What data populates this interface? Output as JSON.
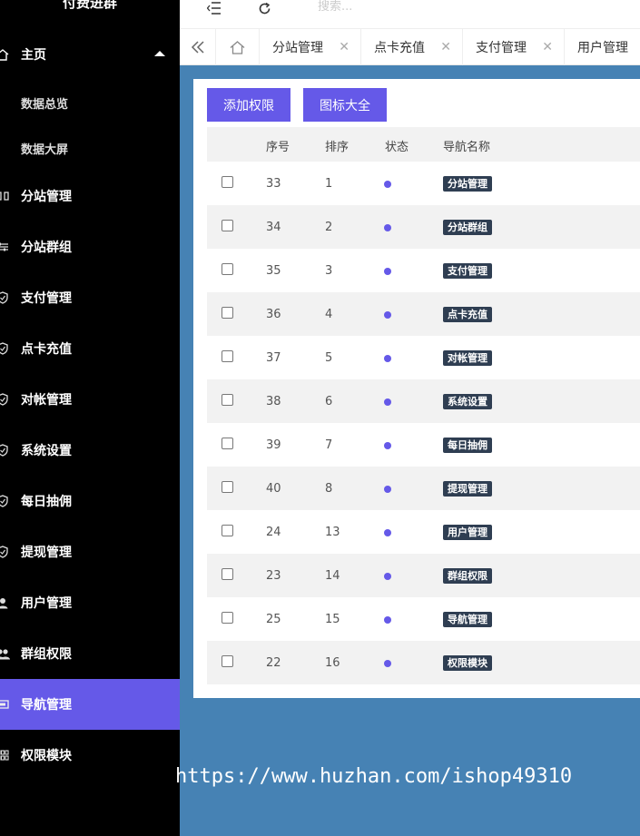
{
  "sidebar": {
    "title": "付费进群",
    "home": {
      "label": "主页",
      "icon": "home-icon"
    },
    "sub_items": [
      "数据总览",
      "数据大屏"
    ],
    "items": [
      {
        "label": "分站管理",
        "icon": "branch-icon"
      },
      {
        "label": "分站群组",
        "icon": "sliders-icon"
      },
      {
        "label": "支付管理",
        "icon": "shield-icon"
      },
      {
        "label": "点卡充值",
        "icon": "shield-icon"
      },
      {
        "label": "对帐管理",
        "icon": "shield-icon"
      },
      {
        "label": "系统设置",
        "icon": "shield-icon"
      },
      {
        "label": "每日抽佣",
        "icon": "shield-icon"
      },
      {
        "label": "提现管理",
        "icon": "shield-icon"
      },
      {
        "label": "用户管理",
        "icon": "user-icon"
      },
      {
        "label": "群组权限",
        "icon": "users-icon"
      },
      {
        "label": "导航管理",
        "icon": "nav-icon",
        "active": true
      },
      {
        "label": "权限模块",
        "icon": "grid-icon"
      }
    ]
  },
  "topbar": {
    "search_placeholder": "搜索..."
  },
  "tabs": [
    {
      "label": "分站管理"
    },
    {
      "label": "点卡充值"
    },
    {
      "label": "支付管理"
    },
    {
      "label": "用户管理"
    }
  ],
  "toolbar": {
    "add_label": "添加权限",
    "icons_label": "图标大全"
  },
  "table": {
    "headers": [
      "序号",
      "排序",
      "状态",
      "导航名称"
    ],
    "rows": [
      {
        "id": "33",
        "order": "1",
        "name": "分站管理"
      },
      {
        "id": "34",
        "order": "2",
        "name": "分站群组"
      },
      {
        "id": "35",
        "order": "3",
        "name": "支付管理"
      },
      {
        "id": "36",
        "order": "4",
        "name": "点卡充值"
      },
      {
        "id": "37",
        "order": "5",
        "name": "对帐管理"
      },
      {
        "id": "38",
        "order": "6",
        "name": "系统设置"
      },
      {
        "id": "39",
        "order": "7",
        "name": "每日抽佣"
      },
      {
        "id": "40",
        "order": "8",
        "name": "提现管理"
      },
      {
        "id": "24",
        "order": "13",
        "name": "用户管理"
      },
      {
        "id": "23",
        "order": "14",
        "name": "群组权限"
      },
      {
        "id": "25",
        "order": "15",
        "name": "导航管理"
      },
      {
        "id": "22",
        "order": "16",
        "name": "权限模块"
      }
    ]
  },
  "watermark": "https://www.huzhan.com/ishop49310",
  "colors": {
    "accent": "#6559e8",
    "sidebar_bg": "#000000",
    "page_bg": "#4682b4",
    "badge_bg": "#2f3e52"
  }
}
